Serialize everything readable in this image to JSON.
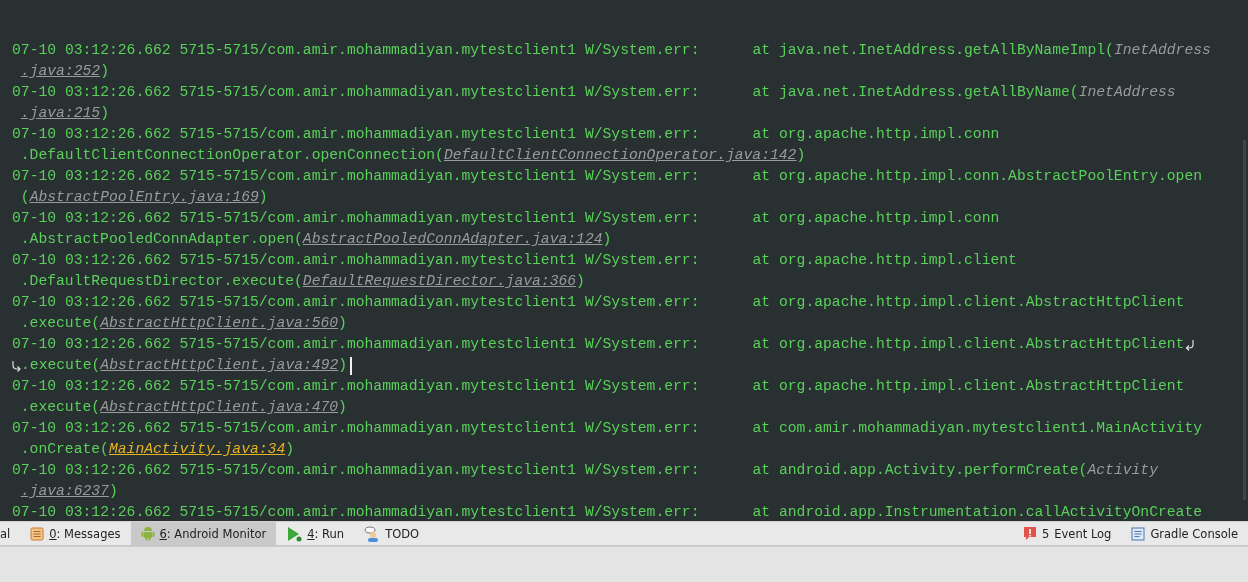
{
  "log": {
    "entries": [
      {
        "prefix": "07-10 03:12:26.662 5715-5715/com.amir.mohammadiyan.mytestclient1 W/System.err:",
        "frame": [
          {
            "t": "at java.net.InetAddress.getAllByNameImpl(",
            "kind": "code"
          },
          {
            "t": "InetAddress",
            "kind": "file"
          }
        ],
        "cont": [
          {
            "t": ".java:252",
            "kind": "link"
          },
          {
            "t": ")",
            "kind": "code"
          }
        ],
        "soft_wrap": false,
        "cursor": false
      },
      {
        "prefix": "07-10 03:12:26.662 5715-5715/com.amir.mohammadiyan.mytestclient1 W/System.err:",
        "frame": [
          {
            "t": "at java.net.InetAddress.getAllByName(",
            "kind": "code"
          },
          {
            "t": "InetAddress",
            "kind": "file"
          }
        ],
        "cont": [
          {
            "t": ".java:215",
            "kind": "link"
          },
          {
            "t": ")",
            "kind": "code"
          }
        ],
        "soft_wrap": false,
        "cursor": false
      },
      {
        "prefix": "07-10 03:12:26.662 5715-5715/com.amir.mohammadiyan.mytestclient1 W/System.err:",
        "frame": [
          {
            "t": "at org.apache.http.impl.conn",
            "kind": "code"
          }
        ],
        "cont": [
          {
            "t": ".DefaultClientConnectionOperator.openConnection(",
            "kind": "code"
          },
          {
            "t": "DefaultClientConnectionOperator.java:142",
            "kind": "link"
          },
          {
            "t": ")",
            "kind": "code"
          }
        ],
        "soft_wrap": false,
        "cursor": false
      },
      {
        "prefix": "07-10 03:12:26.662 5715-5715/com.amir.mohammadiyan.mytestclient1 W/System.err:",
        "frame": [
          {
            "t": "at org.apache.http.impl.conn.AbstractPoolEntry.open",
            "kind": "code"
          }
        ],
        "cont": [
          {
            "t": "(",
            "kind": "code"
          },
          {
            "t": "AbstractPoolEntry.java:169",
            "kind": "link"
          },
          {
            "t": ")",
            "kind": "code"
          }
        ],
        "soft_wrap": false,
        "cursor": false
      },
      {
        "prefix": "07-10 03:12:26.662 5715-5715/com.amir.mohammadiyan.mytestclient1 W/System.err:",
        "frame": [
          {
            "t": "at org.apache.http.impl.conn",
            "kind": "code"
          }
        ],
        "cont": [
          {
            "t": ".AbstractPooledConnAdapter.open(",
            "kind": "code"
          },
          {
            "t": "AbstractPooledConnAdapter.java:124",
            "kind": "link"
          },
          {
            "t": ")",
            "kind": "code"
          }
        ],
        "soft_wrap": false,
        "cursor": false
      },
      {
        "prefix": "07-10 03:12:26.662 5715-5715/com.amir.mohammadiyan.mytestclient1 W/System.err:",
        "frame": [
          {
            "t": "at org.apache.http.impl.client",
            "kind": "code"
          }
        ],
        "cont": [
          {
            "t": ".DefaultRequestDirector.execute(",
            "kind": "code"
          },
          {
            "t": "DefaultRequestDirector.java:366",
            "kind": "link"
          },
          {
            "t": ")",
            "kind": "code"
          }
        ],
        "soft_wrap": false,
        "cursor": false
      },
      {
        "prefix": "07-10 03:12:26.662 5715-5715/com.amir.mohammadiyan.mytestclient1 W/System.err:",
        "frame": [
          {
            "t": "at org.apache.http.impl.client.AbstractHttpClient",
            "kind": "code"
          }
        ],
        "cont": [
          {
            "t": ".execute(",
            "kind": "code"
          },
          {
            "t": "AbstractHttpClient.java:560",
            "kind": "link"
          },
          {
            "t": ")",
            "kind": "code"
          }
        ],
        "soft_wrap": false,
        "cursor": false
      },
      {
        "prefix": "07-10 03:12:26.662 5715-5715/com.amir.mohammadiyan.mytestclient1 W/System.err:",
        "frame": [
          {
            "t": "at org.apache.http.impl.client.AbstractHttpClient",
            "kind": "code"
          }
        ],
        "cont": [
          {
            "t": ".execute(",
            "kind": "code"
          },
          {
            "t": "AbstractHttpClient.java:492",
            "kind": "link"
          },
          {
            "t": ")",
            "kind": "code"
          }
        ],
        "soft_wrap": true,
        "cursor": true
      },
      {
        "prefix": "07-10 03:12:26.662 5715-5715/com.amir.mohammadiyan.mytestclient1 W/System.err:",
        "frame": [
          {
            "t": "at org.apache.http.impl.client.AbstractHttpClient",
            "kind": "code"
          }
        ],
        "cont": [
          {
            "t": ".execute(",
            "kind": "code"
          },
          {
            "t": "AbstractHttpClient.java:470",
            "kind": "link"
          },
          {
            "t": ")",
            "kind": "code"
          }
        ],
        "soft_wrap": false,
        "cursor": false
      },
      {
        "prefix": "07-10 03:12:26.662 5715-5715/com.amir.mohammadiyan.mytestclient1 W/System.err:",
        "frame": [
          {
            "t": "at com.amir.mohammadiyan.mytestclient1.MainActivity",
            "kind": "code"
          }
        ],
        "cont": [
          {
            "t": ".onCreate(",
            "kind": "code"
          },
          {
            "t": "MainActivity.java:34",
            "kind": "app_link"
          },
          {
            "t": ")",
            "kind": "code"
          }
        ],
        "soft_wrap": false,
        "cursor": false
      },
      {
        "prefix": "07-10 03:12:26.662 5715-5715/com.amir.mohammadiyan.mytestclient1 W/System.err:",
        "frame": [
          {
            "t": "at android.app.Activity.performCreate(",
            "kind": "code"
          },
          {
            "t": "Activity",
            "kind": "file"
          }
        ],
        "cont": [
          {
            "t": ".java:6237",
            "kind": "link"
          },
          {
            "t": ")",
            "kind": "code"
          }
        ],
        "soft_wrap": false,
        "cursor": false
      },
      {
        "prefix": "07-10 03:12:26.662 5715-5715/com.amir.mohammadiyan.mytestclient1 W/System.err:",
        "frame": [
          {
            "t": "at android.app.Instrumentation.callActivityOnCreate",
            "kind": "code"
          }
        ],
        "soft_wrap": false,
        "cursor": false
      }
    ]
  },
  "tool_tabs": {
    "left": [
      {
        "label": "al",
        "kind": "plain",
        "mnemonic": false,
        "selected": false
      },
      {
        "label": "0: Messages",
        "kind": "messages",
        "mnemonic": true,
        "selected": false
      },
      {
        "label": "6: Android Monitor",
        "kind": "android",
        "mnemonic": true,
        "selected": true
      },
      {
        "label": "4: Run",
        "kind": "run",
        "mnemonic": true,
        "selected": false
      },
      {
        "label": "TODO",
        "kind": "todo",
        "mnemonic": false,
        "selected": false
      }
    ],
    "right": [
      {
        "label": "Event Log",
        "badge": "5",
        "kind": "event",
        "selected": false
      },
      {
        "label": "Gradle Console",
        "kind": "console",
        "selected": false
      }
    ]
  }
}
